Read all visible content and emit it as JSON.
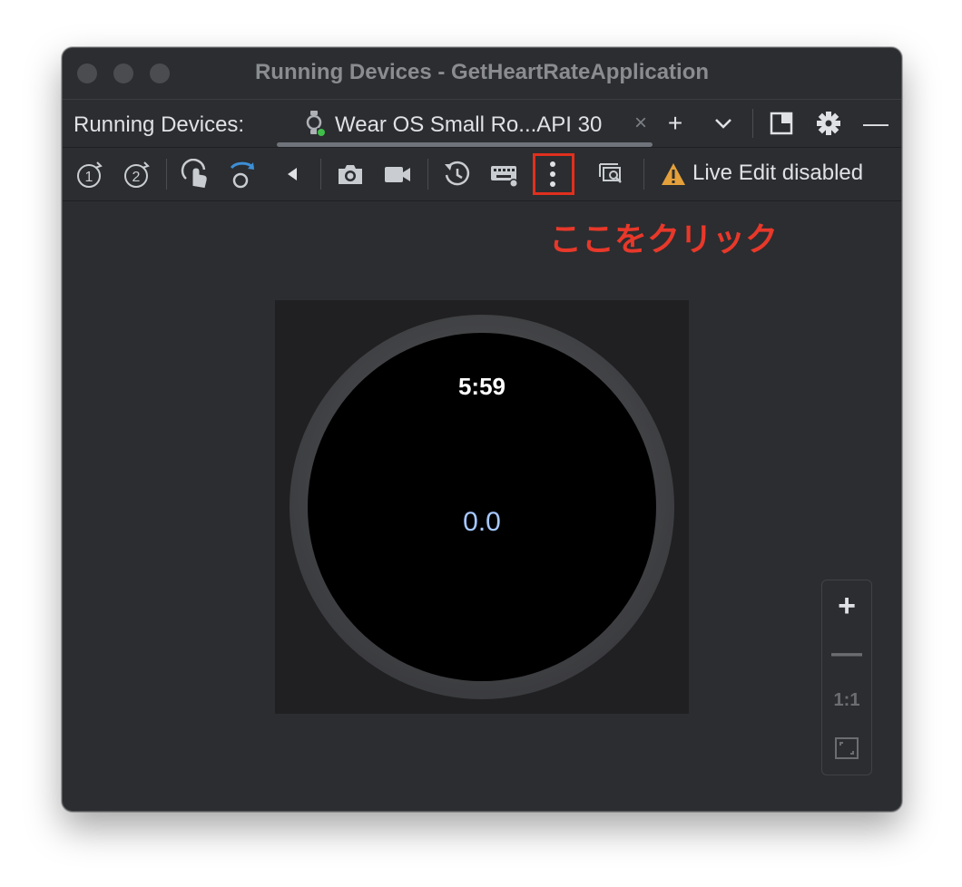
{
  "window": {
    "title": "Running Devices - GetHeartRateApplication"
  },
  "tabbar": {
    "tool_label": "Running Devices:",
    "tab_label": "Wear OS Small Ro...API 30",
    "close_symbol": "×",
    "add_symbol": "+",
    "minimize_symbol": "—"
  },
  "toolbar": {
    "icons": [
      "rotate-1-icon",
      "rotate-2-icon",
      "touch-icon",
      "rotate-icon",
      "back-icon",
      "camera-icon",
      "video-icon",
      "reset-icon",
      "keyboard-icon",
      "more-options-icon",
      "inspect-icon"
    ],
    "live_edit_text": "Live Edit disabled"
  },
  "annotation": {
    "text": "ここをクリック",
    "color": "#e8382a"
  },
  "watch": {
    "time": "5:59",
    "value": "0.0"
  },
  "zoom": {
    "plus": "+",
    "minus": "—",
    "one_to_one": "1:1"
  },
  "colors": {
    "accent_blue": "#3d8fd6",
    "warning": "#e4a03a",
    "background": "#2b2d30"
  }
}
